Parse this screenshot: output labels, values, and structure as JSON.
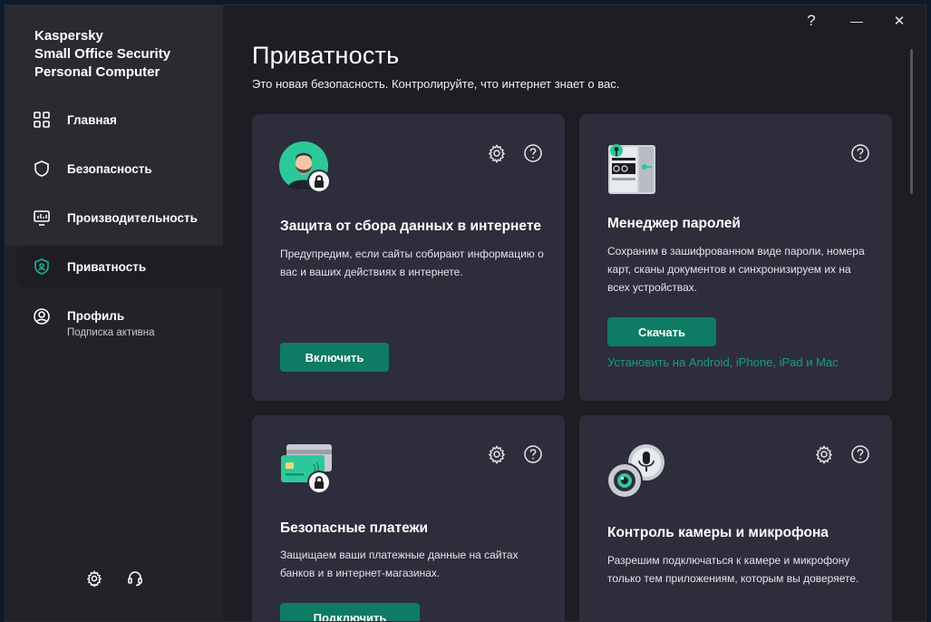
{
  "app": {
    "title_lines": [
      "Kaspersky",
      "Small Office Security",
      "Personal Computer"
    ]
  },
  "titlebar": {
    "help": "?",
    "minimize": "—",
    "close": "✕"
  },
  "sidebar": {
    "items": [
      {
        "label": "Главная",
        "icon": "home-grid-icon"
      },
      {
        "label": "Безопасность",
        "icon": "shield-icon"
      },
      {
        "label": "Производительность",
        "icon": "performance-monitor-icon"
      },
      {
        "label": "Приватность",
        "icon": "privacy-shield-icon",
        "active": true
      },
      {
        "label": "Профиль",
        "sublabel": "Подписка активна",
        "icon": "profile-icon"
      }
    ],
    "bottom_icons": [
      "settings-gear-icon",
      "support-headset-icon"
    ]
  },
  "page": {
    "title": "Приватность",
    "subtitle": "Это новая безопасность. Контролируйте, что интернет знает о вас."
  },
  "cards": [
    {
      "title": "Защита от сбора данных в интернете",
      "desc": "Предупредим, если сайты собирают информацию о вас и ваших действиях в интернете.",
      "button": "Включить",
      "icon": "tracking-protection-icon"
    },
    {
      "title": "Менеджер паролей",
      "desc": "Сохраним в зашифрованном виде пароли, номера карт, сканы документов и синхронизируем их на всех устройствах.",
      "button": "Скачать",
      "link": "Установить на Android, iPhone, iPad и Mac",
      "icon": "password-manager-safe-icon"
    },
    {
      "title": "Безопасные платежи",
      "desc": "Защищаем ваши платежные данные на сайтах банков и в интернет-магазинах.",
      "button": "Подключить",
      "icon": "safe-payments-cards-icon"
    },
    {
      "title": "Контроль камеры и микрофона",
      "desc": "Разрешим подключаться к камере и микрофону только тем приложениям, которым вы доверяете.",
      "icon": "camera-microphone-icon"
    }
  ],
  "colors": {
    "accent": "#0e7b64",
    "link": "#169e7e",
    "card_bg": "#2e2d3b",
    "window_bg": "#1d1d23"
  }
}
